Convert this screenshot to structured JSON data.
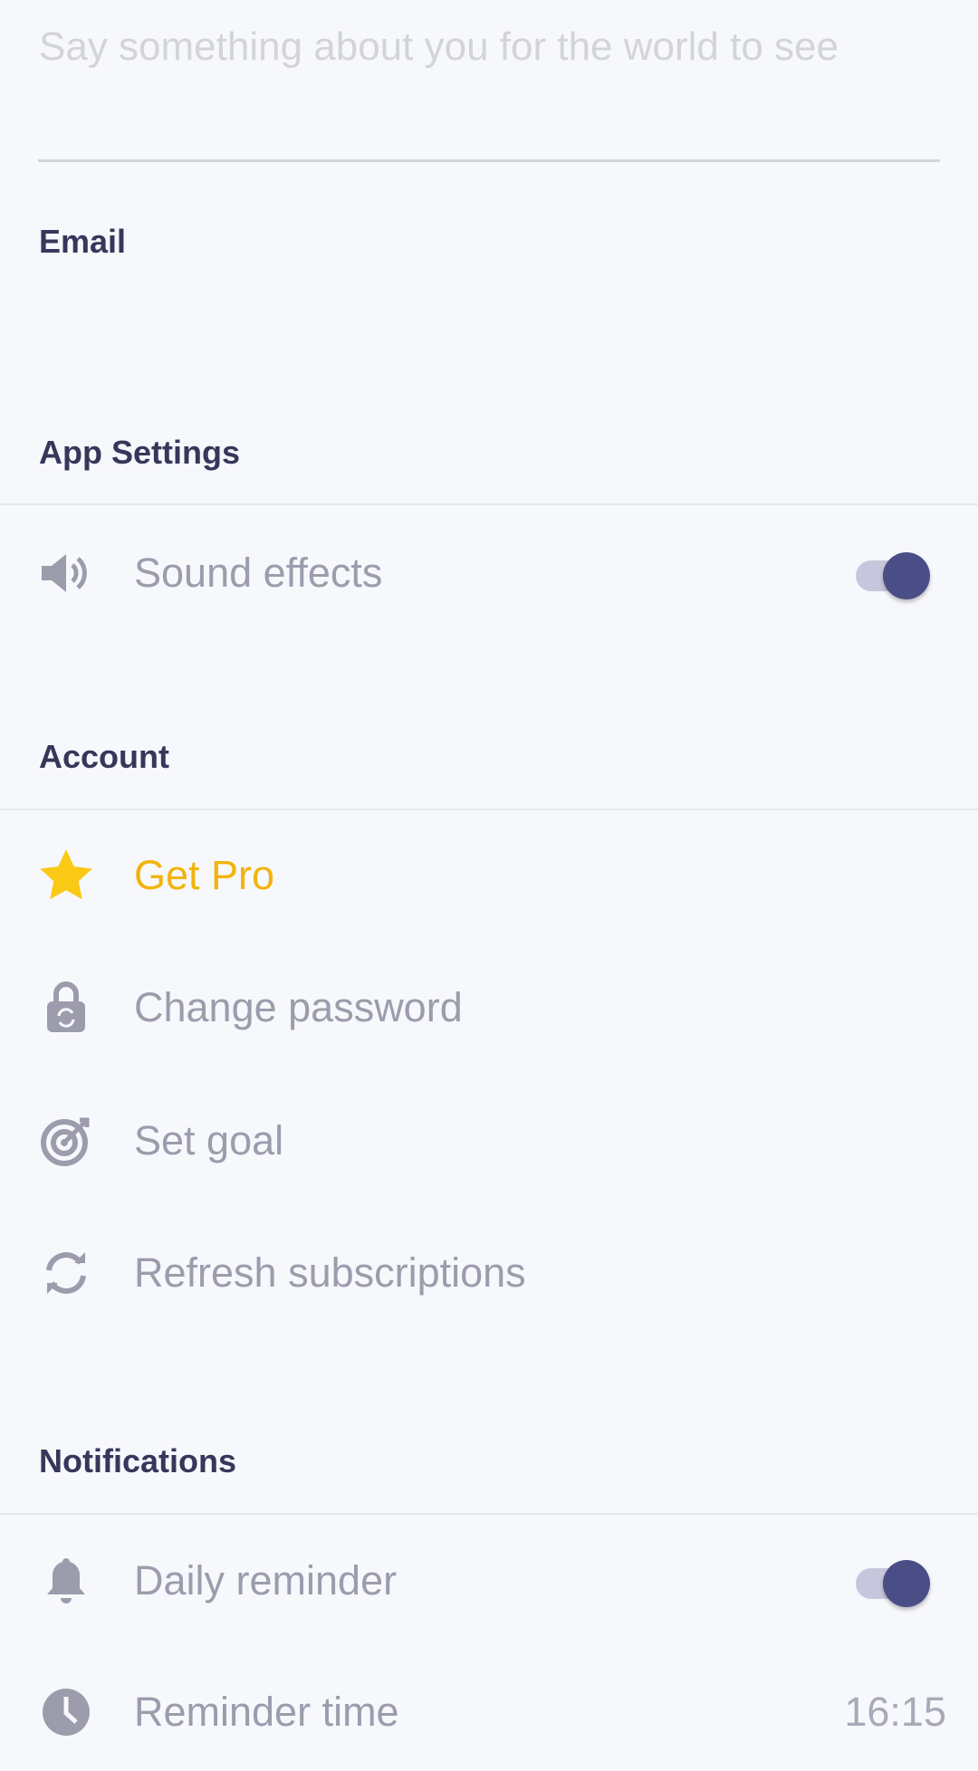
{
  "profile": {
    "bio_placeholder": "Say something about you for the world to see",
    "email_label": "Email",
    "email_value": ""
  },
  "sections": {
    "app_settings": "App Settings",
    "account": "Account",
    "notifications": "Notifications"
  },
  "app_settings": {
    "sound_effects": {
      "label": "Sound effects",
      "enabled": true
    }
  },
  "account": {
    "get_pro": "Get Pro",
    "change_password": "Change password",
    "set_goal": "Set goal",
    "refresh_subscriptions": "Refresh subscriptions"
  },
  "notifications": {
    "daily_reminder": {
      "label": "Daily reminder",
      "enabled": true
    },
    "reminder_time": {
      "label": "Reminder time",
      "value": "16:15"
    }
  },
  "colors": {
    "background": "#f7f8fc",
    "heading": "#36375a",
    "accent": "#4a4d86",
    "pro": "#f5b50a"
  }
}
